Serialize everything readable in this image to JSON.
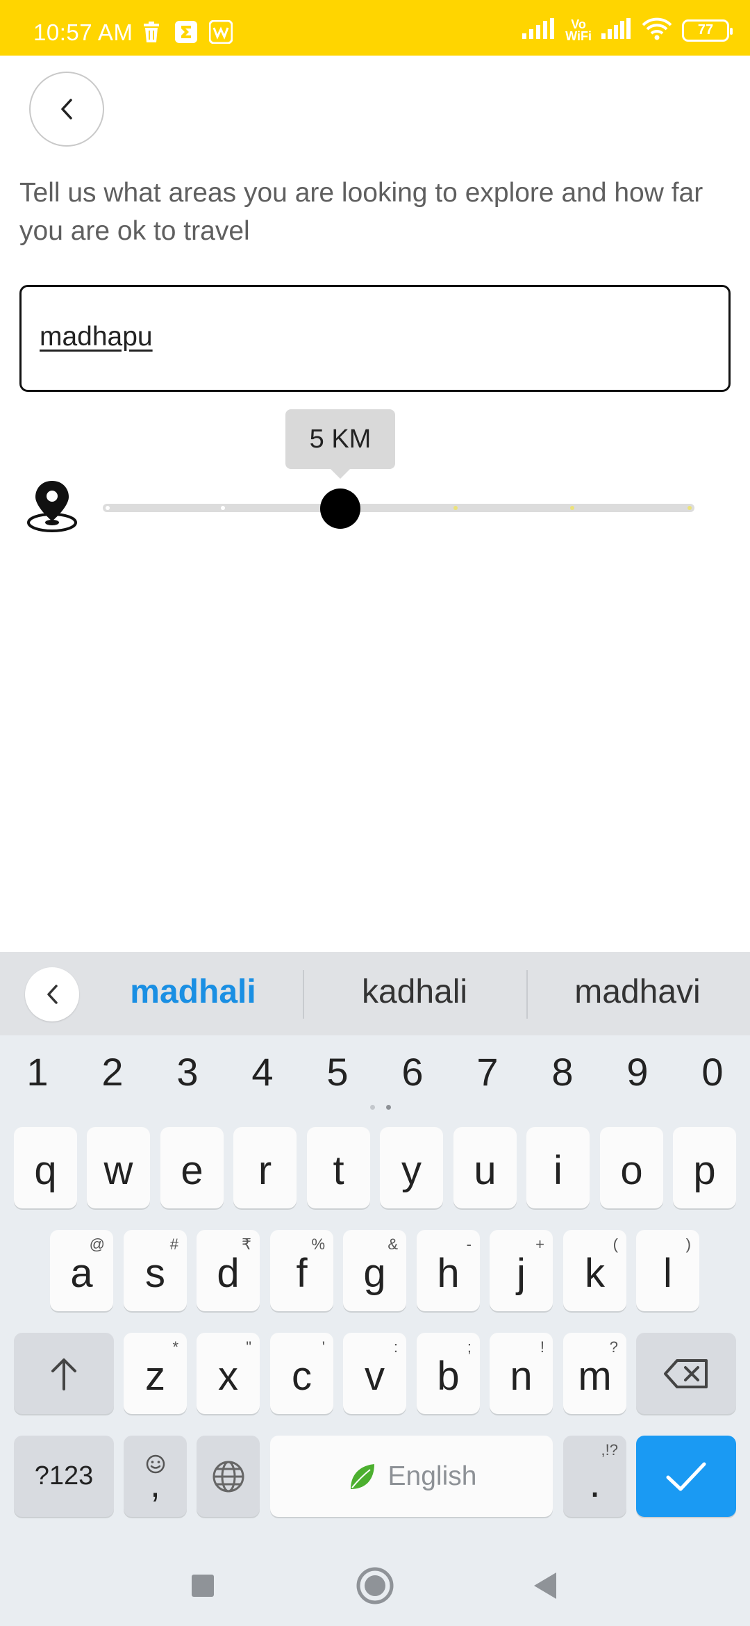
{
  "status_bar": {
    "time": "10:57 AM",
    "battery": "77",
    "wifi_label": "Vo\nWiFi",
    "bg_color": "#FFD500"
  },
  "page": {
    "prompt": "Tell us what areas you are looking to explore and how far you are ok to travel",
    "area_input_value": "madhapu"
  },
  "distance_slider": {
    "label": "5 KM",
    "value": 5,
    "unit": "KM",
    "fraction": 0.4
  },
  "keyboard": {
    "suggestions": [
      "madhali",
      "kadhali",
      "madhavi"
    ],
    "number_row": [
      "1",
      "2",
      "3",
      "4",
      "5",
      "6",
      "7",
      "8",
      "9",
      "0"
    ],
    "row1": [
      "q",
      "w",
      "e",
      "r",
      "t",
      "y",
      "u",
      "i",
      "o",
      "p"
    ],
    "row2": [
      {
        "key": "a",
        "alt": "@"
      },
      {
        "key": "s",
        "alt": "#"
      },
      {
        "key": "d",
        "alt": "₹"
      },
      {
        "key": "f",
        "alt": "%"
      },
      {
        "key": "g",
        "alt": "&"
      },
      {
        "key": "h",
        "alt": "-"
      },
      {
        "key": "j",
        "alt": "+"
      },
      {
        "key": "k",
        "alt": "("
      },
      {
        "key": "l",
        "alt": ")"
      }
    ],
    "row3": [
      {
        "key": "z",
        "alt": "*"
      },
      {
        "key": "x",
        "alt": "\""
      },
      {
        "key": "c",
        "alt": "'"
      },
      {
        "key": "v",
        "alt": ":"
      },
      {
        "key": "b",
        "alt": ";"
      },
      {
        "key": "n",
        "alt": "!"
      },
      {
        "key": "m",
        "alt": "?"
      }
    ],
    "symbols_label": "?123",
    "comma_label": ",",
    "period_label": ".",
    "period_alt": ",!?",
    "space_label": "English",
    "accent_color": "#1a9af3"
  }
}
